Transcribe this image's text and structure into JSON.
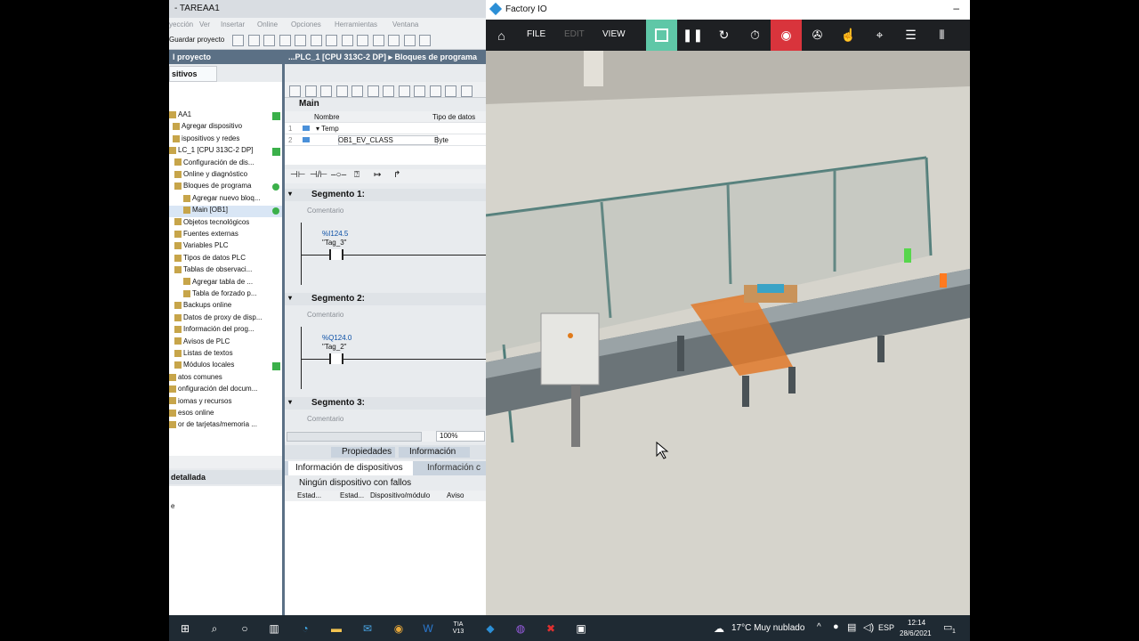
{
  "tia": {
    "title": "- TAREAA1",
    "menu": [
      "yección",
      "Ver",
      "Insertar",
      "Online",
      "Opciones",
      "Herramientas",
      "Ventana"
    ],
    "save_label": "Guardar proyecto",
    "project_header": "l proyecto",
    "devices_tab": "sitivos",
    "tree": [
      {
        "label": "AA1",
        "status": "ok"
      },
      {
        "label": "Agregar dispositivo"
      },
      {
        "label": "ispositivos y redes"
      },
      {
        "label": "LC_1 [CPU 313C-2 DP]",
        "status": "ok"
      },
      {
        "label": "Configuración de dis..."
      },
      {
        "label": "Online y diagnóstico"
      },
      {
        "label": "Bloques de programa",
        "status": "dot"
      },
      {
        "label": "Agregar nuevo bloq..."
      },
      {
        "label": "Main [OB1]",
        "status": "dot",
        "selected": true
      },
      {
        "label": "Objetos tecnológicos"
      },
      {
        "label": "Fuentes externas"
      },
      {
        "label": "Variables PLC"
      },
      {
        "label": "Tipos de datos PLC"
      },
      {
        "label": "Tablas de observaci..."
      },
      {
        "label": "Agregar tabla de ..."
      },
      {
        "label": "Tabla de forzado p..."
      },
      {
        "label": "Backups online"
      },
      {
        "label": "Datos de proxy de disp..."
      },
      {
        "label": "Información del prog..."
      },
      {
        "label": "Avisos de PLC"
      },
      {
        "label": "Listas de textos"
      },
      {
        "label": "Módulos locales",
        "status": "ok"
      },
      {
        "label": "atos comunes"
      },
      {
        "label": "onfiguración del docum..."
      },
      {
        "label": "iomas y recursos"
      },
      {
        "label": "esos online"
      },
      {
        "label": "or de tarjetas/memoria ..."
      }
    ],
    "detail_header": "detallada",
    "detail_row": "e",
    "editor_title": "...PLC_1 [CPU 313C-2 DP] ▸ Bloques de programa",
    "main_label": "Main",
    "iface_cols": [
      "Nombre",
      "Tipo de datos"
    ],
    "iface_rows": [
      {
        "num": "1",
        "name": "▾ Temp",
        "type": ""
      },
      {
        "num": "2",
        "name": "OB1_EV_CLASS",
        "type": "Byte"
      }
    ],
    "segments": [
      {
        "title": "Segmento 1:",
        "comment": "Comentario",
        "address": "%I124.5",
        "tag": "\"Tag_3\""
      },
      {
        "title": "Segmento 2:",
        "comment": "Comentario",
        "address": "%Q124.0",
        "tag": "\"Tag_2\""
      },
      {
        "title": "Segmento 3:",
        "comment": "Comentario"
      }
    ],
    "zoom": "100%",
    "inspector_tabs": [
      "Propiedades",
      "Información"
    ],
    "inspector_subtabs": [
      "Información de dispositivos",
      "Información c"
    ],
    "no_faults": "Ningún dispositivo con fallos",
    "diag_cols": [
      "Estad...",
      "Estad...",
      "Dispositivo/módulo",
      "Aviso"
    ]
  },
  "factory_io": {
    "title": "Factory IO",
    "menu": [
      "FILE",
      "EDIT",
      "VIEW"
    ],
    "toolbar_icons": [
      "stop-icon",
      "pause-icon",
      "reset-icon",
      "timer-icon",
      "record-icon",
      "sensor-icon",
      "touch-icon",
      "target-icon",
      "list-icon",
      "antenna-icon"
    ]
  },
  "taskbar": {
    "weather": "17°C  Muy nublado",
    "lang": "ESP",
    "time": "12:14",
    "date": "28/6/2021",
    "notif": "1",
    "apps": [
      "TIA V13"
    ]
  }
}
